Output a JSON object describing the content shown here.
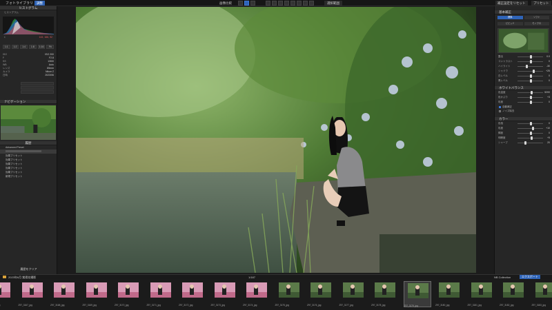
{
  "app": {
    "title": "フォトライブラリ",
    "tab_active": "調整"
  },
  "toolbar": {
    "left_label": "画像比較",
    "mode_label": "調整",
    "right_label": "選択範囲",
    "right_buttons": [
      "補正設定をリセット",
      "プリセット"
    ]
  },
  "left_panel": {
    "histogram_header": "ヒストグラム",
    "histogram_sub": "ヒストグラム",
    "rgb_value": "143, 166, 92",
    "buttons": [
      "1:1",
      "1:2",
      "1:4",
      "1:8",
      "1:16",
      "Fit"
    ],
    "info_rows": [
      {
        "k": "ISO",
        "v": "ISO 200"
      },
      {
        "k": "F",
        "v": "F2.8"
      },
      {
        "k": "SS",
        "v": "1/500"
      },
      {
        "k": "WB",
        "v": "Auto"
      },
      {
        "k": "レンズ",
        "v": "85mm"
      },
      {
        "k": "カメラ",
        "v": "Nikon Z"
      },
      {
        "k": "日時",
        "v": "2023/06"
      }
    ],
    "navigator_header": "ナビゲーション",
    "presets_header": "履歴",
    "presets": [
      "Advanced Preset",
      "効果プリセット",
      "効果プリセット",
      "効果プリセット",
      "効果プリセット",
      "効果プリセット",
      "新規プリセット"
    ],
    "bottom_label": "履歴をクリア"
  },
  "right_panel": {
    "header": "基本補正",
    "toggles": [
      "標準",
      "ソフト",
      "ビビッド",
      "モノクロ"
    ],
    "sliders": [
      {
        "label": "露出",
        "value": "0.0",
        "pos": 0.5
      },
      {
        "label": "コントラスト",
        "value": "0",
        "pos": 0.5
      },
      {
        "label": "ハイライト",
        "value": "-30",
        "pos": 0.35
      },
      {
        "label": "シャドウ",
        "value": "+25",
        "pos": 0.62
      },
      {
        "label": "白レベル",
        "value": "0",
        "pos": 0.5
      },
      {
        "label": "黒レベル",
        "value": "0",
        "pos": 0.5
      }
    ],
    "section2": "ホワイトバランス",
    "sliders2": [
      {
        "label": "色温度",
        "value": "5200",
        "pos": 0.55
      },
      {
        "label": "色かぶり",
        "value": "+3",
        "pos": 0.52
      },
      {
        "label": "彩度",
        "value": "0",
        "pos": 0.5
      }
    ],
    "checks": [
      "自動補正",
      "ノイズ除去"
    ],
    "section3": "カラー",
    "sliders3": [
      {
        "label": "色相",
        "value": "0",
        "pos": 0.5
      },
      {
        "label": "彩度",
        "value": "+10",
        "pos": 0.6
      },
      {
        "label": "輝度",
        "value": "0",
        "pos": 0.5
      },
      {
        "label": "明瞭度",
        "value": "+5",
        "pos": 0.55
      },
      {
        "label": "シャープ",
        "value": "20",
        "pos": 0.3
      }
    ]
  },
  "filmstrip": {
    "path": "2023年6月 紫陽花撮影",
    "count": "1/187",
    "collection": "NB Collection",
    "export_label": "エクスポート",
    "captions": [
      "Z97_3166_jpg",
      "Z97_3167_jpg",
      "Z97_3168_jpg",
      "Z97_3169_jpg",
      "Z97_3170_jpg",
      "Z97_3171_jpg",
      "Z97_3172_jpg",
      "Z97_3173_jpg",
      "Z97_3174_jpg",
      "Z97_3175_jpg",
      "Z97_3176_jpg",
      "Z97_3177_jpg",
      "Z97_3178_jpg",
      "Z97_3179_jpg",
      "Z97_3180_jpg",
      "Z97_3181_jpg",
      "Z97_3182_jpg",
      "Z97_3183_jpg"
    ]
  }
}
